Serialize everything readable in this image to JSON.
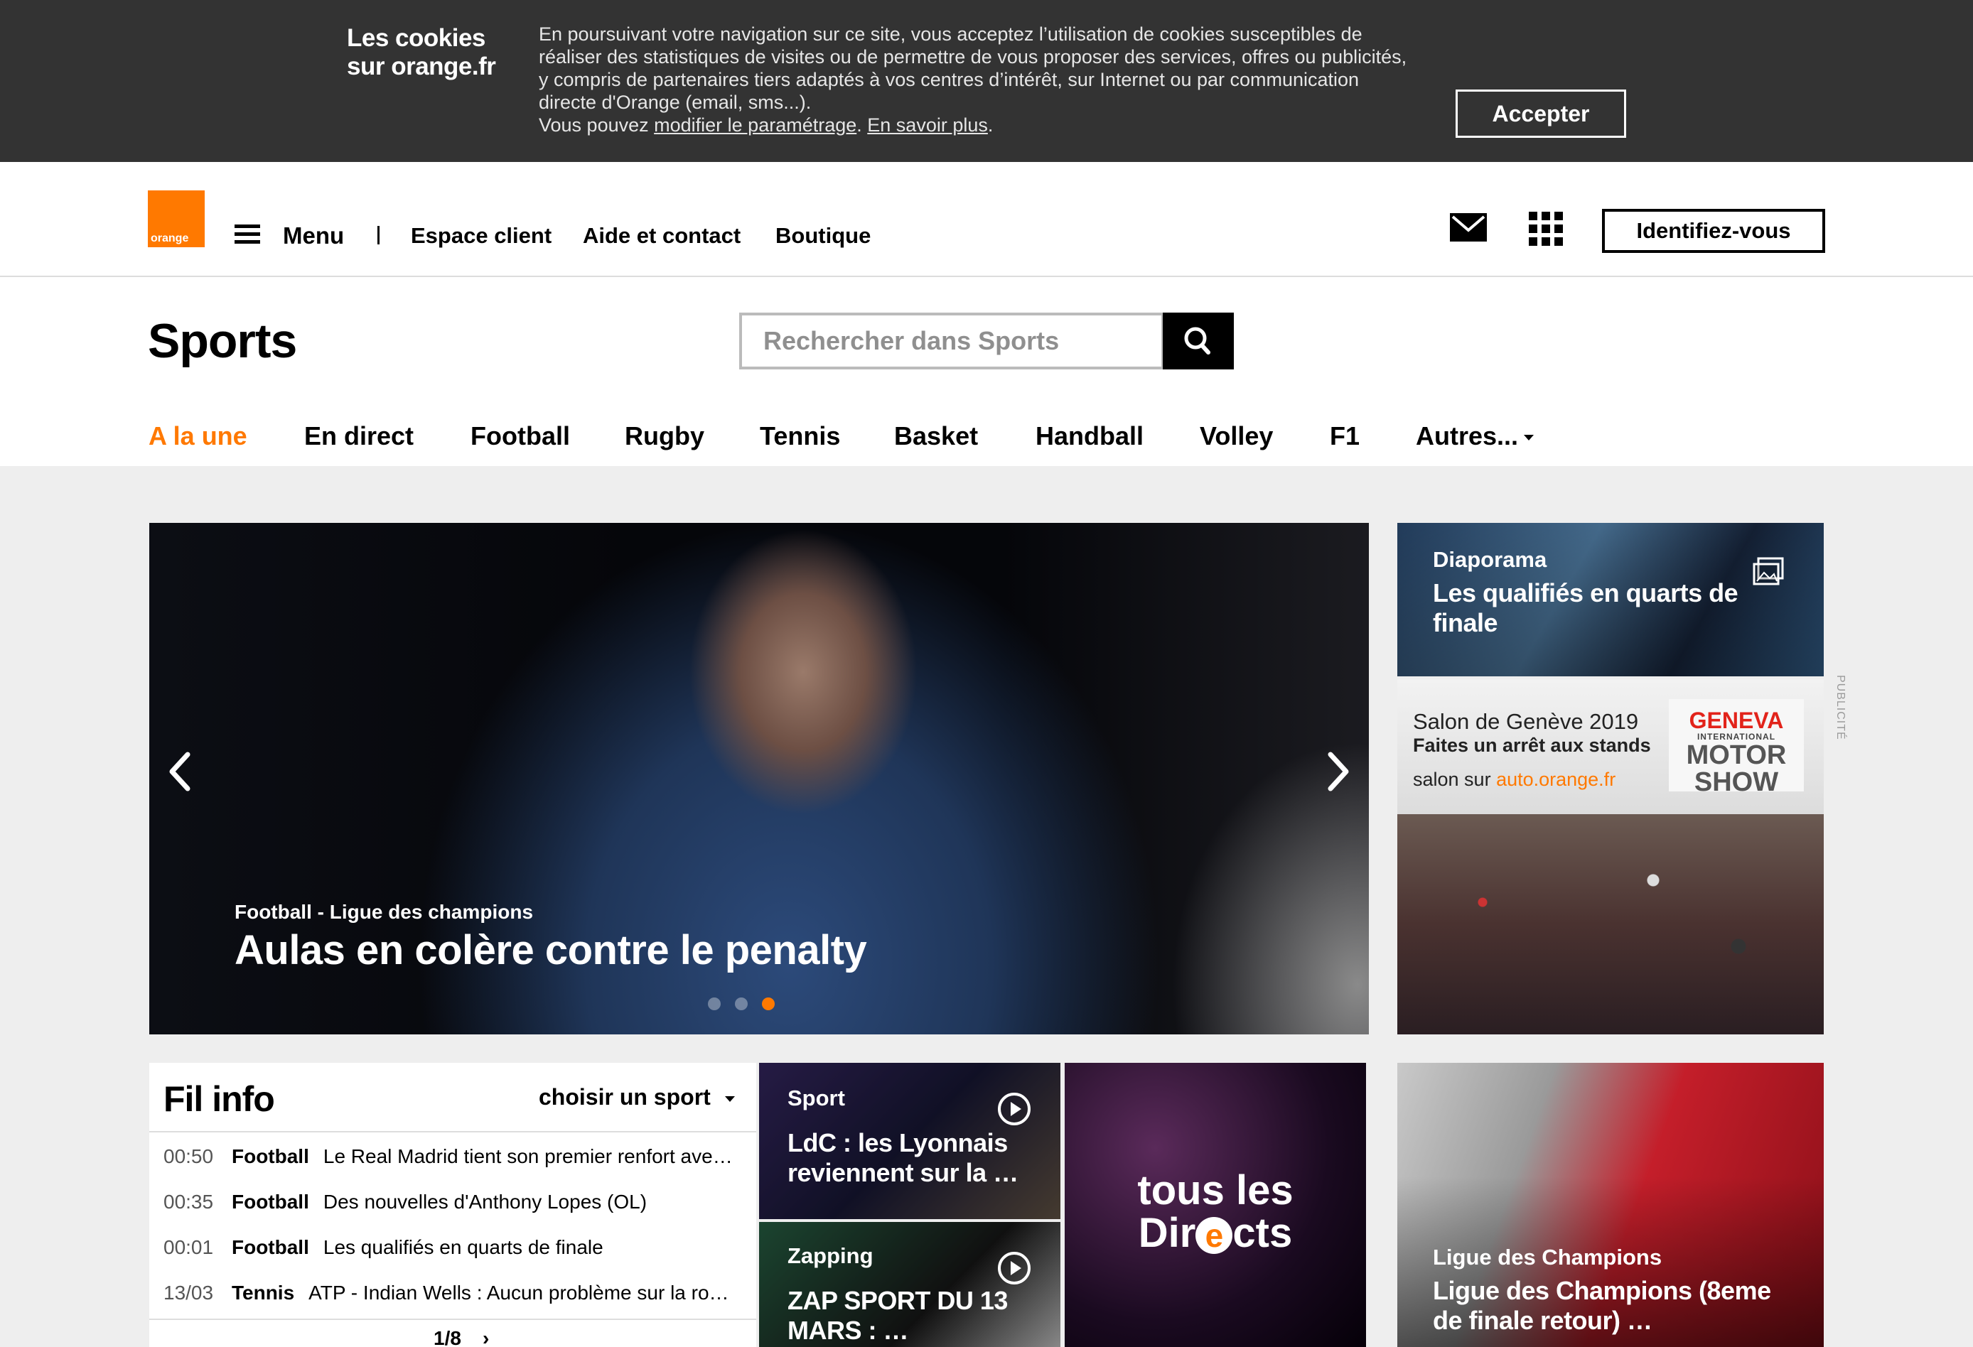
{
  "cookie": {
    "title_line1": "Les cookies",
    "title_line2": "sur orange.fr",
    "text_line1": "En poursuivant votre navigation sur ce site, vous acceptez l’utilisation de cookies susceptibles de",
    "text_line2": "réaliser des statistiques de visites ou de permettre de vous proposer des services, offres ou publicités,",
    "text_line3": "y compris de partenaires tiers adaptés à vos centres d’intérêt, sur Internet ou par communication",
    "text_line4": "directe d'Orange (email, sms...).",
    "text_line5_prefix": "Vous pouvez ",
    "link_modify": "modifier le paramétrage",
    "sep": ". ",
    "link_more": "En savoir plus",
    "end": ".",
    "accept_label": "Accepter"
  },
  "header": {
    "logo_text": "orange",
    "menu_label": "Menu",
    "links": [
      "Espace client",
      "Aide et contact",
      "Boutique"
    ],
    "login_label": "Identifiez-vous"
  },
  "page": {
    "title": "Sports",
    "search_placeholder": "Rechercher dans Sports"
  },
  "nav": {
    "items": [
      "A la une",
      "En direct",
      "Football",
      "Rugby",
      "Tennis",
      "Basket",
      "Handball",
      "Volley",
      "F1",
      "Autres..."
    ],
    "active_index": 0
  },
  "hero": {
    "category": "Football - Ligue des champions",
    "title": "Aulas en colère contre le penalty",
    "slide_count": 3,
    "active_slide": 3
  },
  "diaporama": {
    "category": "Diaporama",
    "title_line1": "Les qualifiés en quarts de",
    "title_line2": "finale"
  },
  "ad": {
    "line1": "Salon de Genève 2019",
    "line2": "Faites un arrêt aux stands",
    "line3_prefix": "salon sur ",
    "line3_link": "auto.orange.fr",
    "logo_line1": "GENEVA",
    "logo_line2": "INTERNATIONAL",
    "logo_line3": "MOTOR",
    "logo_line4": "SHOW",
    "label": "PUBLICITÉ"
  },
  "fil_info": {
    "title": "Fil info",
    "choose_label": "choisir un sport",
    "rows": [
      {
        "time": "00:50",
        "sport": "Football",
        "text": "Le Real Madrid tient son premier renfort ave…"
      },
      {
        "time": "00:35",
        "sport": "Football",
        "text": "Des nouvelles d'Anthony Lopes (OL)"
      },
      {
        "time": "00:01",
        "sport": "Football",
        "text": "Les qualifiés en quarts de finale"
      },
      {
        "time": "13/03",
        "sport": "Tennis",
        "text": "ATP - Indian Wells : Aucun problème sur la ro…"
      }
    ],
    "pagination": "1/8"
  },
  "tiles": {
    "sport": {
      "category": "Sport",
      "title_line1": "LdC : les Lyonnais",
      "title_line2": "reviennent sur la …"
    },
    "zapping": {
      "category": "Zapping",
      "title_line1": "ZAP SPORT DU 13",
      "title_line2": "MARS : …"
    },
    "directs": {
      "line1": "tous les",
      "line2_a": "Dir",
      "line2_e": "e",
      "line2_b": "cts"
    },
    "ldc": {
      "category": "Ligue des Champions",
      "title_line1": "Ligue des Champions (8eme",
      "title_line2": "de finale retour) …"
    }
  },
  "colors": {
    "accent": "#ff7900",
    "banner": "#333333",
    "page_bg": "#eeeeee"
  }
}
